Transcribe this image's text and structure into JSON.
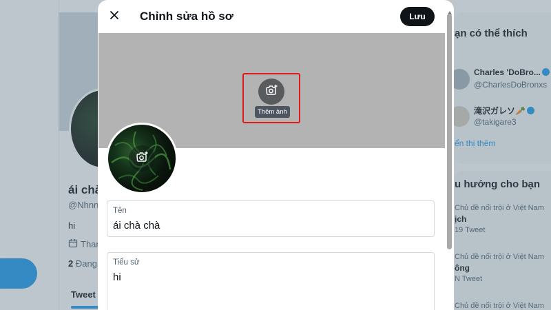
{
  "background": {
    "profile": {
      "name": "ái chà",
      "handle": "@Nhnn",
      "bio": "hi",
      "joined": "Thar",
      "following": "2",
      "following_label": "Đang",
      "tab": "Tweet"
    },
    "sidebar": {
      "who_to_follow_title": "ạn có thể thích",
      "users": [
        {
          "name": "Charles 'DoBro...",
          "handle": "@CharlesDoBronxs"
        },
        {
          "name": "滝沢ガレソ🥕",
          "handle": "@takigare3"
        }
      ],
      "show_more": "ển thị thêm",
      "trends_title": "u hướng cho bạn",
      "trends": [
        {
          "context": "Chủ đề nổi trội ở Việt Nam",
          "title": "ịch",
          "count": "19 Tweet"
        },
        {
          "context": "Chủ đề nổi trội ở Việt Nam",
          "title": "ông",
          "count": "N Tweet"
        },
        {
          "context": "Chủ đề nổi trội ở Việt Nam",
          "title": "",
          "count": ""
        }
      ]
    }
  },
  "modal": {
    "title": "Chỉnh sửa hồ sơ",
    "save_label": "Lưu",
    "add_photo_tooltip": "Thêm ảnh",
    "name_field": {
      "label": "Tên",
      "value": "ái chà chà"
    },
    "bio_field": {
      "label": "Tiểu sử",
      "value": "hi"
    }
  },
  "colors": {
    "overlay": "#5b7083",
    "accent": "#1d9bf0",
    "highlight_box": "#e0191b",
    "banner": "#b3b3b3",
    "save_button": "#0f1419"
  }
}
